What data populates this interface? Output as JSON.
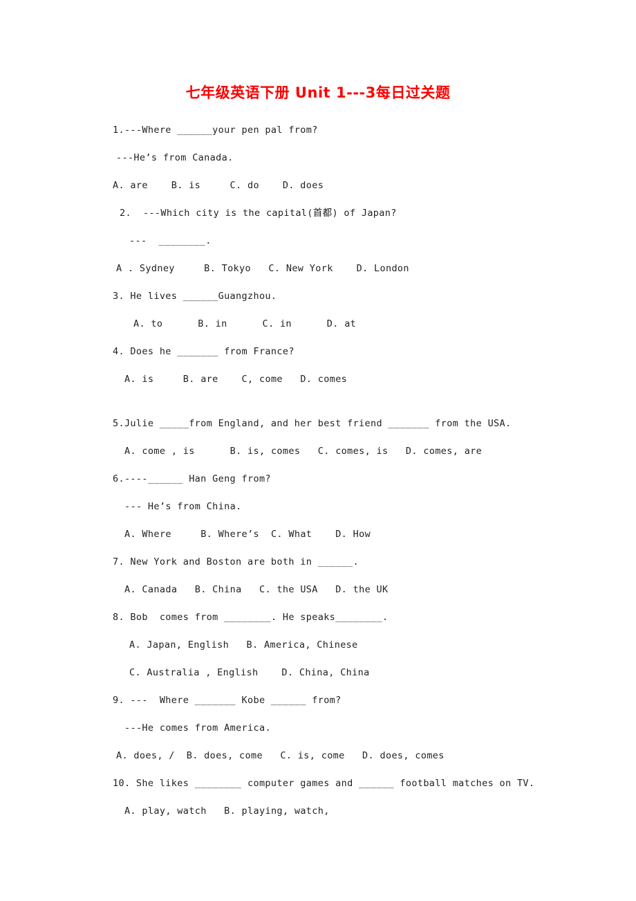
{
  "document": {
    "title": "七年级英语下册 Unit 1---3每日过关题",
    "title_color": "#fe0000",
    "background_color": "#ffffff",
    "body_color": "#222222"
  },
  "questions": [
    {
      "number": "1.",
      "lines": [
        "1.---Where ______your pen pal from?",
        "---He’s from Canada.",
        "A. are    B. is     C. do    D. does"
      ]
    },
    {
      "number": "2.",
      "lines": [
        "2.  ---Which city is the capital(首都) of Japan?",
        "---  ________.",
        "A . Sydney     B. Tokyo   C. New York    D. London"
      ]
    },
    {
      "number": "3.",
      "lines": [
        "3. He lives ______Guangzhou.",
        "A. to      B. in      C. in      D. at"
      ]
    },
    {
      "number": "4.",
      "lines": [
        "4. Does he _______ from France?",
        "A. is     B. are    C, come   D. comes"
      ]
    },
    {
      "number": "5.",
      "lines": [
        "5.Julie _____from England, and her best friend _______ from the USA.",
        "A. come , is      B. is, comes   C. comes, is   D. comes, are"
      ]
    },
    {
      "number": "6.",
      "lines": [
        "6.----______ Han Geng from?",
        "--- He’s from China.",
        "A. Where     B. Where’s  C. What    D. How"
      ]
    },
    {
      "number": "7.",
      "lines": [
        "7. New York and Boston are both in ______.",
        "A. Canada   B. China   C. the USA   D. the UK"
      ]
    },
    {
      "number": "8.",
      "lines": [
        "8. Bob  comes from ________. He speaks________.",
        "A. Japan, English   B. America, Chinese",
        "C. Australia , English    D. China, China"
      ]
    },
    {
      "number": "9.",
      "lines": [
        "9. ---  Where _______ Kobe ______ from?",
        "---He comes from America.",
        "A. does, /  B. does, come   C. is, come   D. does, comes"
      ]
    },
    {
      "number": "10.",
      "lines": [
        "10. She likes ________ computer games and ______ football matches on TV.",
        "A. play, watch   B. playing, watch,"
      ]
    }
  ],
  "lines_flat": {
    "q1_l1": "1.---Where ______your pen pal from?",
    "q1_l2": "---He’s from Canada.",
    "q1_l3": "A. are    B. is     C. do    D. does",
    "q2_l1": "2.  ---Which city is the capital(首都) of Japan?",
    "q2_l2": "---  ________.",
    "q2_l3": "A . Sydney     B. Tokyo   C. New York    D. London",
    "q3_l1": "3. He lives ______Guangzhou.",
    "q3_l2": "A. to      B. in      C. in      D. at",
    "q4_l1": "4. Does he _______ from France?",
    "q4_l2": "A. is     B. are    C, come   D. comes",
    "q5_l1": "5.Julie _____from England, and her best friend _______ from the USA.",
    "q5_l2": "A. come , is      B. is, comes   C. comes, is   D. comes, are",
    "q6_l1": "6.----______ Han Geng from?",
    "q6_l2": "--- He’s from China.",
    "q6_l3": "A. Where     B. Where’s  C. What    D. How",
    "q7_l1": "7. New York and Boston are both in ______.",
    "q7_l2": "A. Canada   B. China   C. the USA   D. the UK",
    "q8_l1": "8. Bob  comes from ________. He speaks________.",
    "q8_l2": "A. Japan, English   B. America, Chinese",
    "q8_l3": "C. Australia , English    D. China, China",
    "q9_l1": "9. ---  Where _______ Kobe ______ from?",
    "q9_l2": "---He comes from America.",
    "q9_l3": "A. does, /  B. does, come   C. is, come   D. does, comes",
    "q10_l1": "10. She likes ________ computer games and ______ football matches on TV.",
    "q10_l2": "A. play, watch   B. playing, watch,"
  }
}
